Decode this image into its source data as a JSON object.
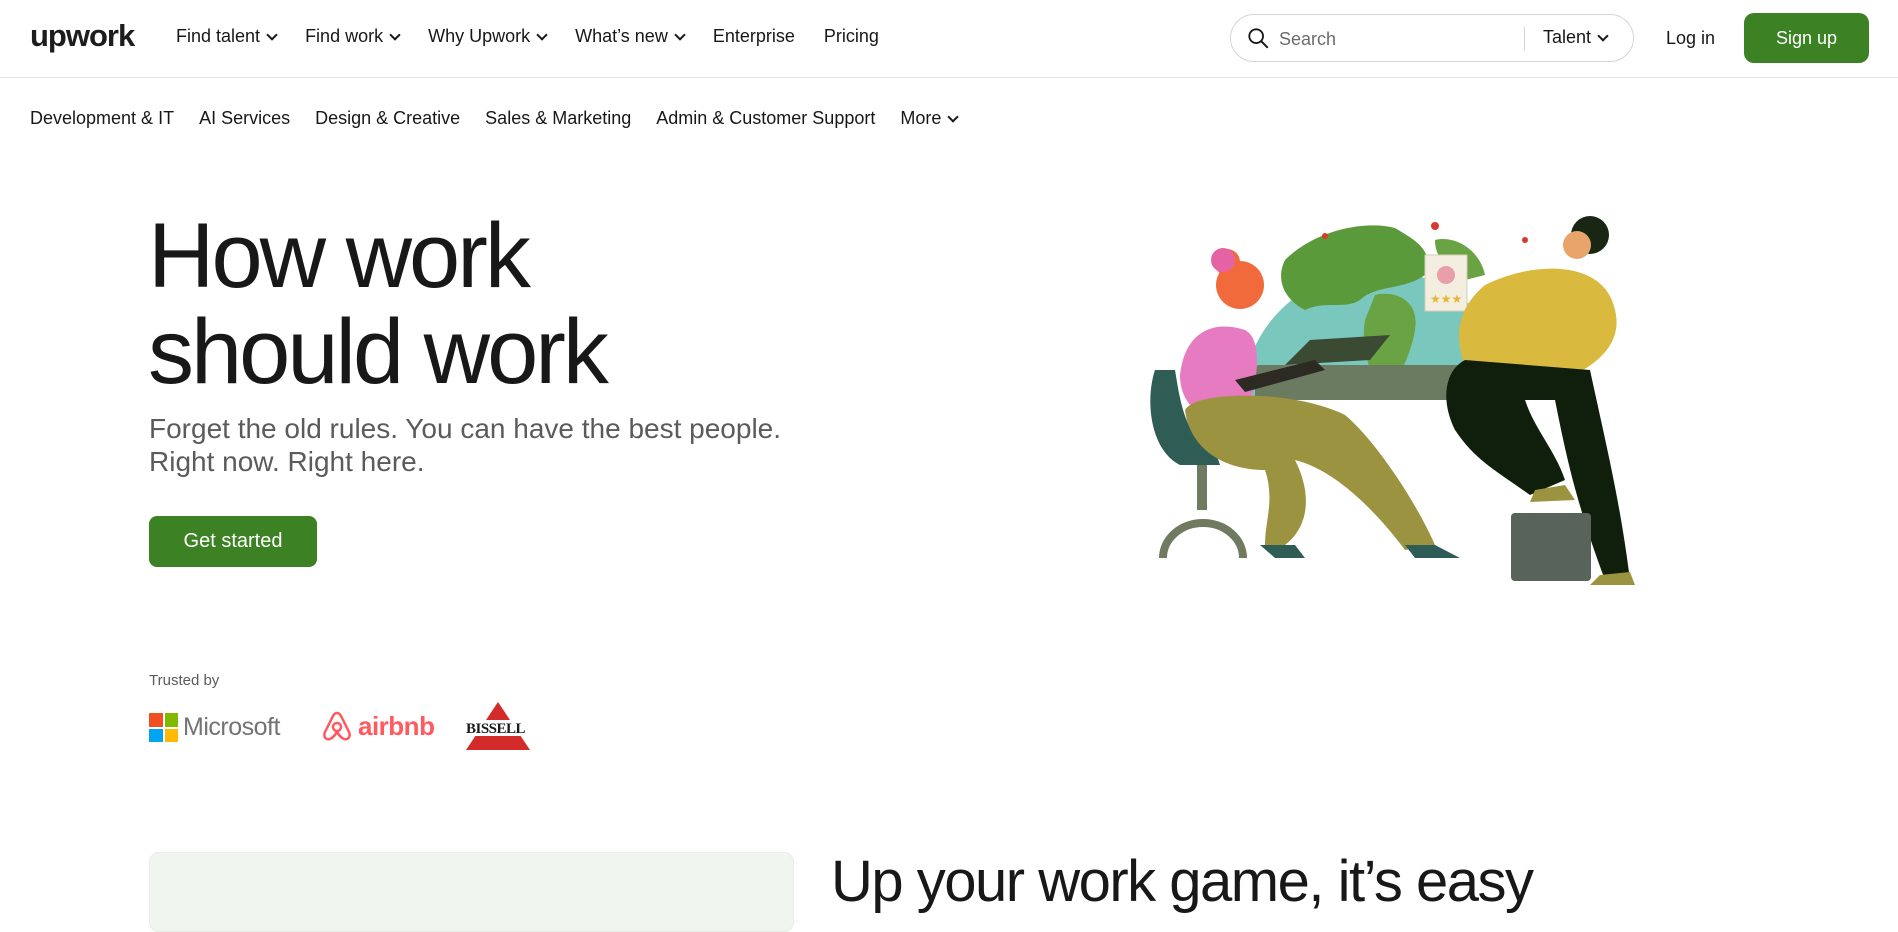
{
  "brand": {
    "logo_text": "upwork",
    "accent": "#3c8224"
  },
  "topnav": {
    "links": [
      {
        "label": "Find talent",
        "has_dropdown": true
      },
      {
        "label": "Find work",
        "has_dropdown": true
      },
      {
        "label": "Why Upwork",
        "has_dropdown": true
      },
      {
        "label": "What’s new",
        "has_dropdown": true
      },
      {
        "label": "Enterprise",
        "has_dropdown": false
      },
      {
        "label": "Pricing",
        "has_dropdown": false
      }
    ],
    "search": {
      "placeholder": "Search",
      "scope": "Talent"
    },
    "login_label": "Log in",
    "signup_label": "Sign up"
  },
  "categories": {
    "items": [
      "Development & IT",
      "AI Services",
      "Design & Creative",
      "Sales & Marketing",
      "Admin & Customer Support"
    ],
    "more_label": "More"
  },
  "hero": {
    "title_line1": "How work",
    "title_line2": "should work",
    "subtitle_line1": "Forget the old rules. You can have the best people.",
    "subtitle_line2": "Right now. Right here.",
    "cta_label": "Get started"
  },
  "trusted": {
    "label": "Trusted by",
    "logos": [
      "Microsoft",
      "airbnb",
      "BISSELL"
    ]
  },
  "section2": {
    "title": "Up your work game, it’s easy"
  }
}
